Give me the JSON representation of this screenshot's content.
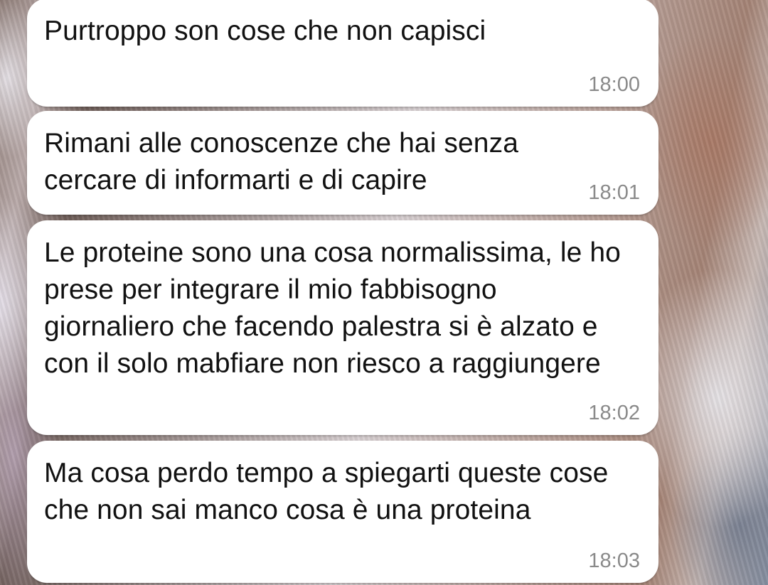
{
  "messages": [
    {
      "text": "Purtroppo son cose che non capisci",
      "time": "18:00"
    },
    {
      "text": "Rimani alle conoscenze che hai senza cercare di informarti e di capire",
      "time": "18:01"
    },
    {
      "text": "Le proteine sono una cosa normalissima, le ho prese per integrare il mio fabbisogno giornaliero che facendo palestra si è alzato e con il solo mabfiare non riesco a raggiungere",
      "time": "18:02"
    },
    {
      "text": "Ma cosa perdo tempo a spiegarti queste cose che non sai manco cosa è una proteina",
      "time": "18:03"
    }
  ],
  "colors": {
    "bubble": "#ffffff",
    "text": "#111111",
    "timestamp": "#8a8a8a"
  }
}
